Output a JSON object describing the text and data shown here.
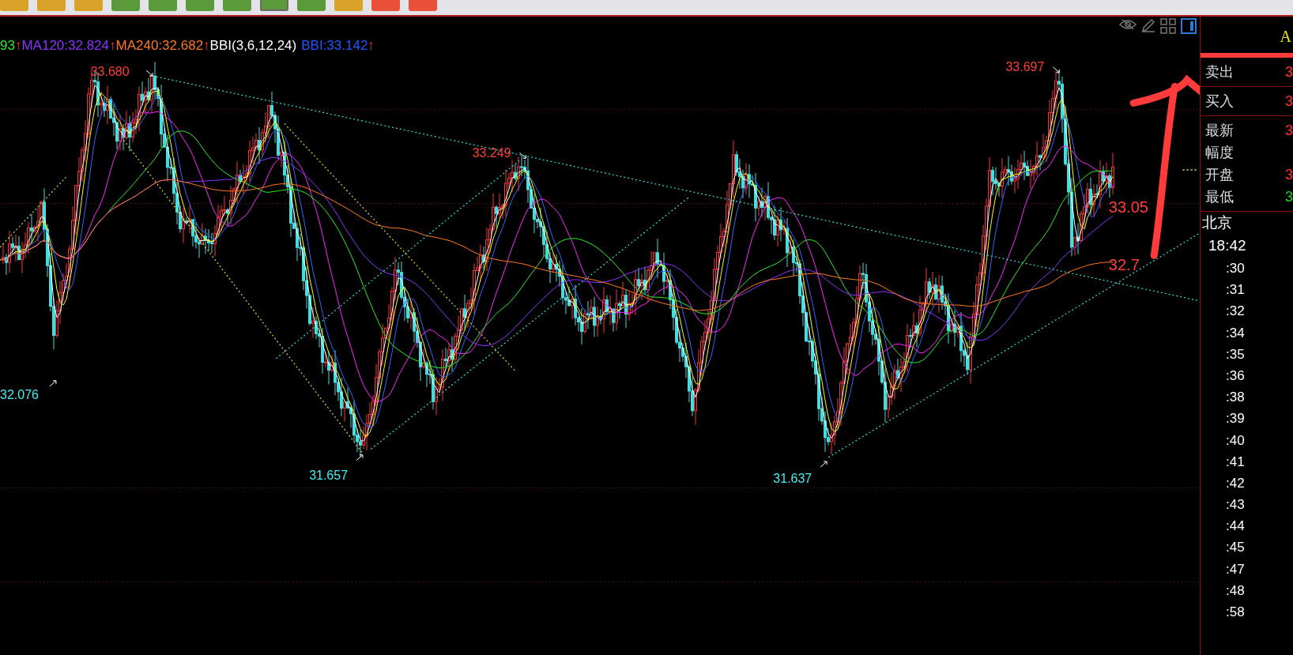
{
  "toolbar": {
    "buttons": [
      {
        "color": "#d9a228",
        "selected": false
      },
      {
        "color": "#d9a228",
        "selected": false
      },
      {
        "color": "#d9a228",
        "selected": false
      },
      {
        "color": "#5a9a3a",
        "selected": false
      },
      {
        "color": "#5a9a3a",
        "selected": false
      },
      {
        "color": "#5a9a3a",
        "selected": false
      },
      {
        "color": "#5a9a3a",
        "selected": false
      },
      {
        "color": "#5a9a3a",
        "selected": true
      },
      {
        "color": "#5a9a3a",
        "selected": false
      },
      {
        "color": "#d9a228",
        "selected": false
      },
      {
        "color": "#e8503a",
        "selected": false
      },
      {
        "color": "#e8503a",
        "selected": false
      }
    ]
  },
  "legend": [
    {
      "text": "93",
      "color": "#22ee22",
      "arrow": "↑"
    },
    {
      "text": "MA120:32.824",
      "color": "#8833ff",
      "arrow": "↑"
    },
    {
      "text": "MA240:32.682",
      "color": "#ff7722",
      "arrow": "↑"
    },
    {
      "text": "BBI(3,6,12,24)",
      "color": "#ffffff"
    },
    {
      "text": "BBI:33.142",
      "color": "#2255ff",
      "arrow": "↑"
    }
  ],
  "price_marks": [
    {
      "text": "33.680",
      "kind": "high"
    },
    {
      "text": "32.076",
      "kind": "low"
    },
    {
      "text": "31.657",
      "kind": "low"
    },
    {
      "text": "33.249",
      "kind": "high"
    },
    {
      "text": "31.637",
      "kind": "low"
    },
    {
      "text": "33.697",
      "kind": "high"
    }
  ],
  "handwritten_notes": [
    "33.05",
    "32.7"
  ],
  "quote_panel": {
    "title": "A",
    "groups": [
      [
        {
          "label": "卖出",
          "value": "3",
          "color": "#ff3333"
        }
      ],
      [
        {
          "label": "买入",
          "value": "3",
          "color": "#ff3333"
        }
      ],
      [
        {
          "label": "最新",
          "value": "3",
          "color": "#ff3333"
        },
        {
          "label": "幅度"
        },
        {
          "label": "开盘",
          "value": "3",
          "color": "#ff3333"
        },
        {
          "label": "最低",
          "value": "3",
          "color": "#22cc22"
        }
      ]
    ]
  },
  "ticks": {
    "zone": "北京",
    "first": "18:42",
    "times": [
      ":30",
      ":31",
      ":32",
      ":34",
      ":35",
      ":36",
      ":38",
      ":39",
      ":40",
      ":41",
      ":42",
      ":43",
      ":44",
      ":45",
      ":47",
      ":48",
      ":58"
    ]
  }
}
